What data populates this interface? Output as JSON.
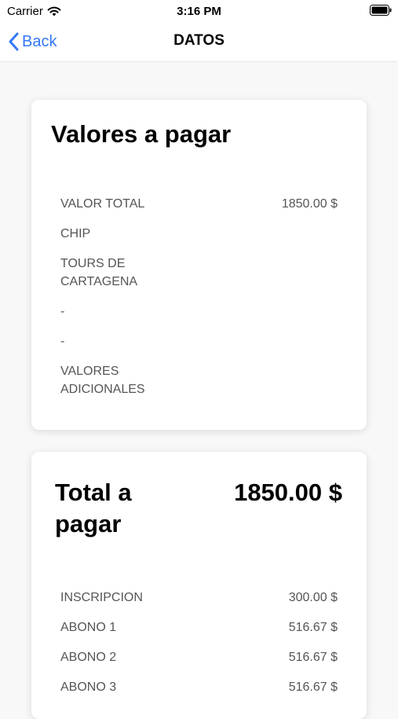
{
  "status": {
    "carrier": "Carrier",
    "time": "3:16 PM"
  },
  "nav": {
    "back_label": "Back",
    "title": "DATOS"
  },
  "values_card": {
    "title": "Valores a pagar",
    "rows": [
      {
        "label": "VALOR TOTAL",
        "value": "1850.00 $"
      },
      {
        "label": "CHIP",
        "value": ""
      },
      {
        "label": "TOURS DE CARTAGENA",
        "value": ""
      },
      {
        "label": "-",
        "value": ""
      },
      {
        "label": "-",
        "value": ""
      },
      {
        "label": "VALORES ADICIONALES",
        "value": ""
      }
    ]
  },
  "total_card": {
    "title": "Total a pagar",
    "total": "1850.00 $",
    "rows": [
      {
        "label": "INSCRIPCION",
        "value": "300.00 $"
      },
      {
        "label": "ABONO 1",
        "value": "516.67 $"
      },
      {
        "label": "ABONO 2",
        "value": "516.67 $"
      },
      {
        "label": "ABONO 3",
        "value": "516.67 $"
      }
    ]
  },
  "colors": {
    "accent": "#3478f6",
    "background": "#f8f8f8",
    "card": "#ffffff",
    "label_text": "#555555"
  }
}
